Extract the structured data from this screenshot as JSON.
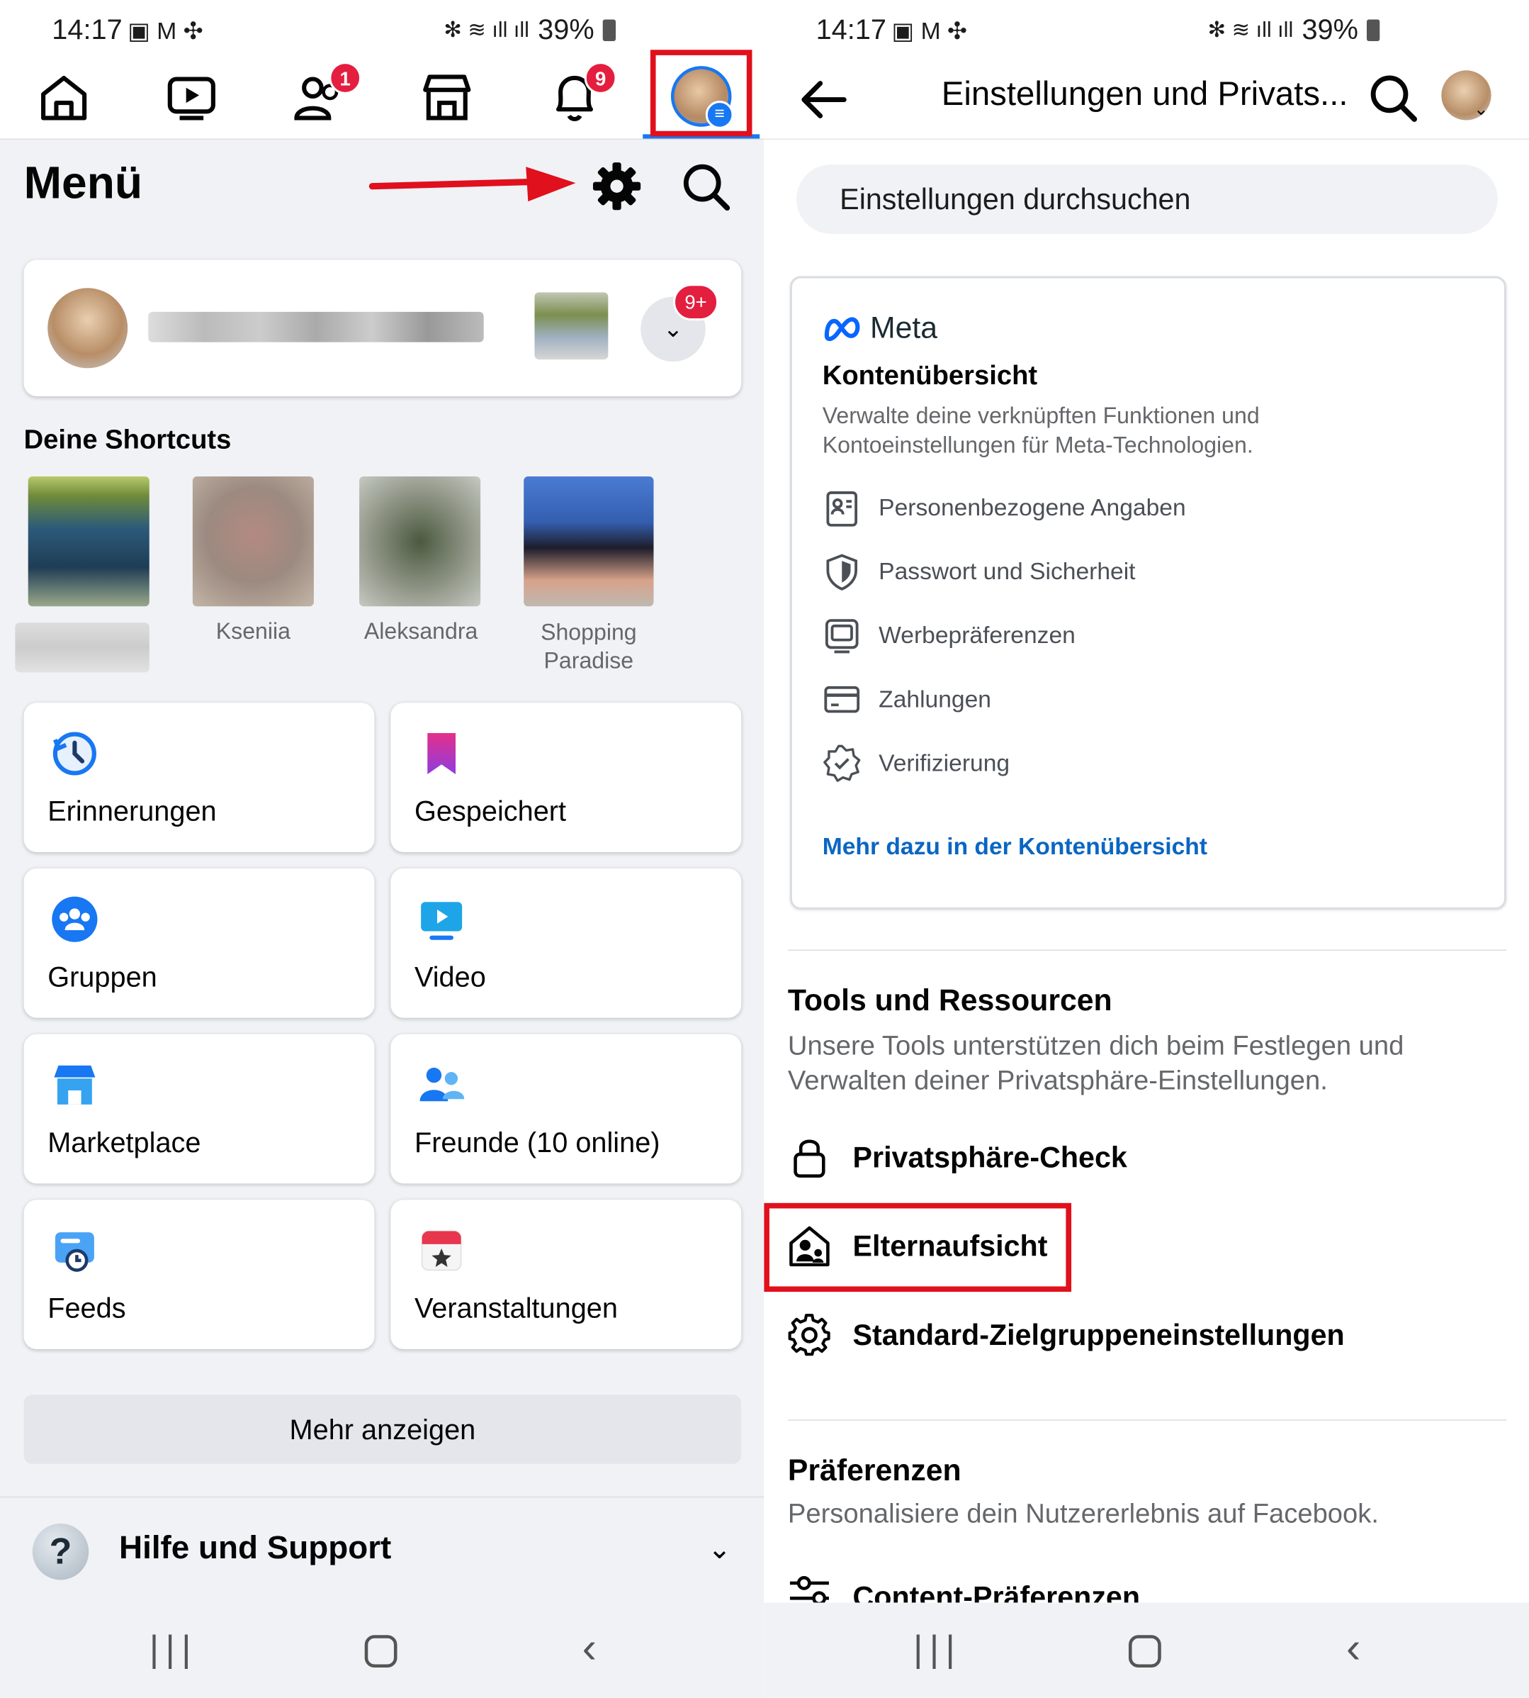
{
  "status": {
    "time": "14:17",
    "battery": "39%"
  },
  "left": {
    "nav": {
      "friends_badge": "1",
      "notif_badge": "9"
    },
    "header": {
      "title": "Menü"
    },
    "profile": {
      "badge": "9+"
    },
    "shortcuts": {
      "title": "Deine Shortcuts",
      "items": [
        {
          "label": ""
        },
        {
          "label": "Kseniia"
        },
        {
          "label": "Aleksandra"
        },
        {
          "label": "Shopping\nParadise"
        }
      ]
    },
    "tiles": [
      {
        "label": "Erinnerungen",
        "icon": "clock-icon"
      },
      {
        "label": "Gespeichert",
        "icon": "bookmark-icon"
      },
      {
        "label": "Gruppen",
        "icon": "groups-icon"
      },
      {
        "label": "Video",
        "icon": "video-icon"
      },
      {
        "label": "Marketplace",
        "icon": "shop-icon"
      },
      {
        "label": "Freunde (10 online)",
        "icon": "friends-icon"
      },
      {
        "label": "Feeds",
        "icon": "feeds-icon"
      },
      {
        "label": "Veranstaltungen",
        "icon": "calendar-icon"
      }
    ],
    "more_button": "Mehr anzeigen",
    "help": "Hilfe und Support"
  },
  "right": {
    "header": {
      "title": "Einstellungen und Privats..."
    },
    "search": {
      "placeholder": "Einstellungen durchsuchen"
    },
    "meta": {
      "logo": "Meta",
      "title": "Kontenübersicht",
      "desc": "Verwalte deine verknüpften Funktionen und Kontoeinstellungen für Meta-Technologien.",
      "items": [
        "Personenbezogene Angaben",
        "Passwort und Sicherheit",
        "Werbepräferenzen",
        "Zahlungen",
        "Verifizierung"
      ],
      "link": "Mehr dazu in der Kontenübersicht"
    },
    "tools": {
      "title": "Tools und Ressourcen",
      "desc": "Unsere Tools unterstützen dich beim Festlegen und Verwalten deiner Privatsphäre-Einstellungen.",
      "items": [
        "Privatsphäre-Check",
        "Elternaufsicht",
        "Standard-Zielgruppeneinstellungen"
      ]
    },
    "prefs": {
      "title": "Präferenzen",
      "desc": "Personalisiere dein Nutzererlebnis auf Facebook.",
      "first_item": "Content-Präferenzen"
    }
  },
  "colors": {
    "accent": "#1877f2",
    "highlight": "#e0101c",
    "link": "#0a66c2"
  }
}
